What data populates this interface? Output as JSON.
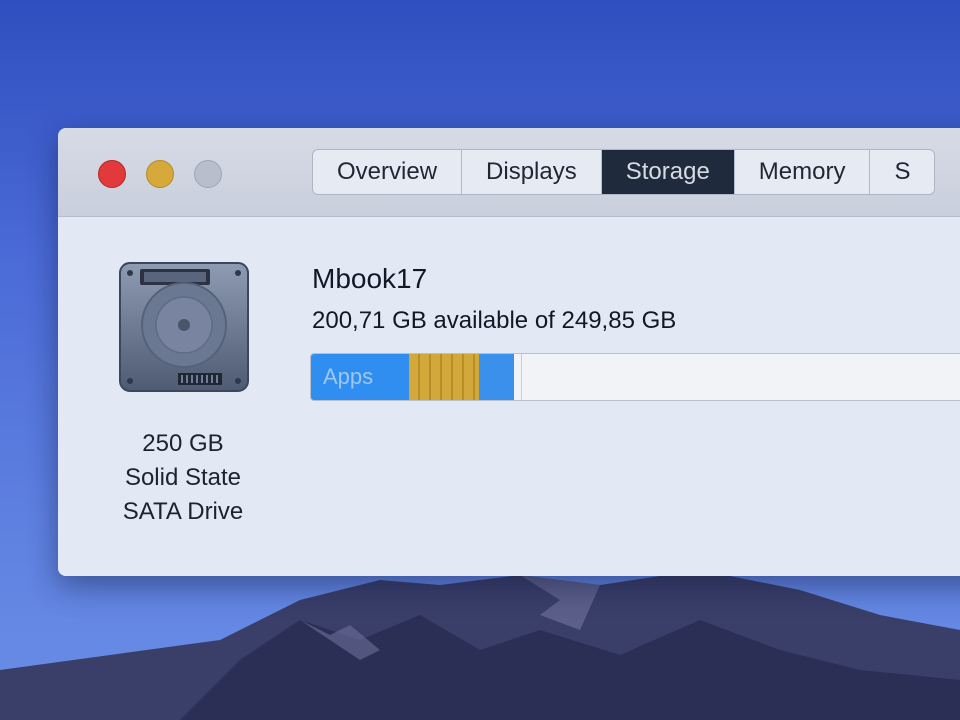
{
  "window": {
    "tabs": [
      {
        "label": "Overview",
        "active": false
      },
      {
        "label": "Displays",
        "active": false
      },
      {
        "label": "Storage",
        "active": true
      },
      {
        "label": "Memory",
        "active": false
      },
      {
        "label": "S",
        "active": false
      }
    ]
  },
  "disk": {
    "icon": "hard-drive-icon",
    "caption_line1": "250 GB",
    "caption_line2": "Solid State",
    "caption_line3": "SATA Drive"
  },
  "volume": {
    "name": "Mbook17",
    "available_text": "200,71 GB available of 249,85 GB"
  },
  "storage_bar": {
    "segments": [
      {
        "label": "Apps",
        "fraction": 0.14,
        "color": "#2f8ef0"
      },
      {
        "label": "",
        "fraction": 0.1,
        "color": "#d2a83b"
      },
      {
        "label": "",
        "fraction": 0.05,
        "color": "#3a90ea"
      }
    ],
    "free_color": "#f1f3f7"
  },
  "colors": {
    "close": "#e23a3a",
    "minimize": "#d7a83a",
    "zoom": "#b7bfcd",
    "active_tab_bg": "#1f2a3c"
  }
}
